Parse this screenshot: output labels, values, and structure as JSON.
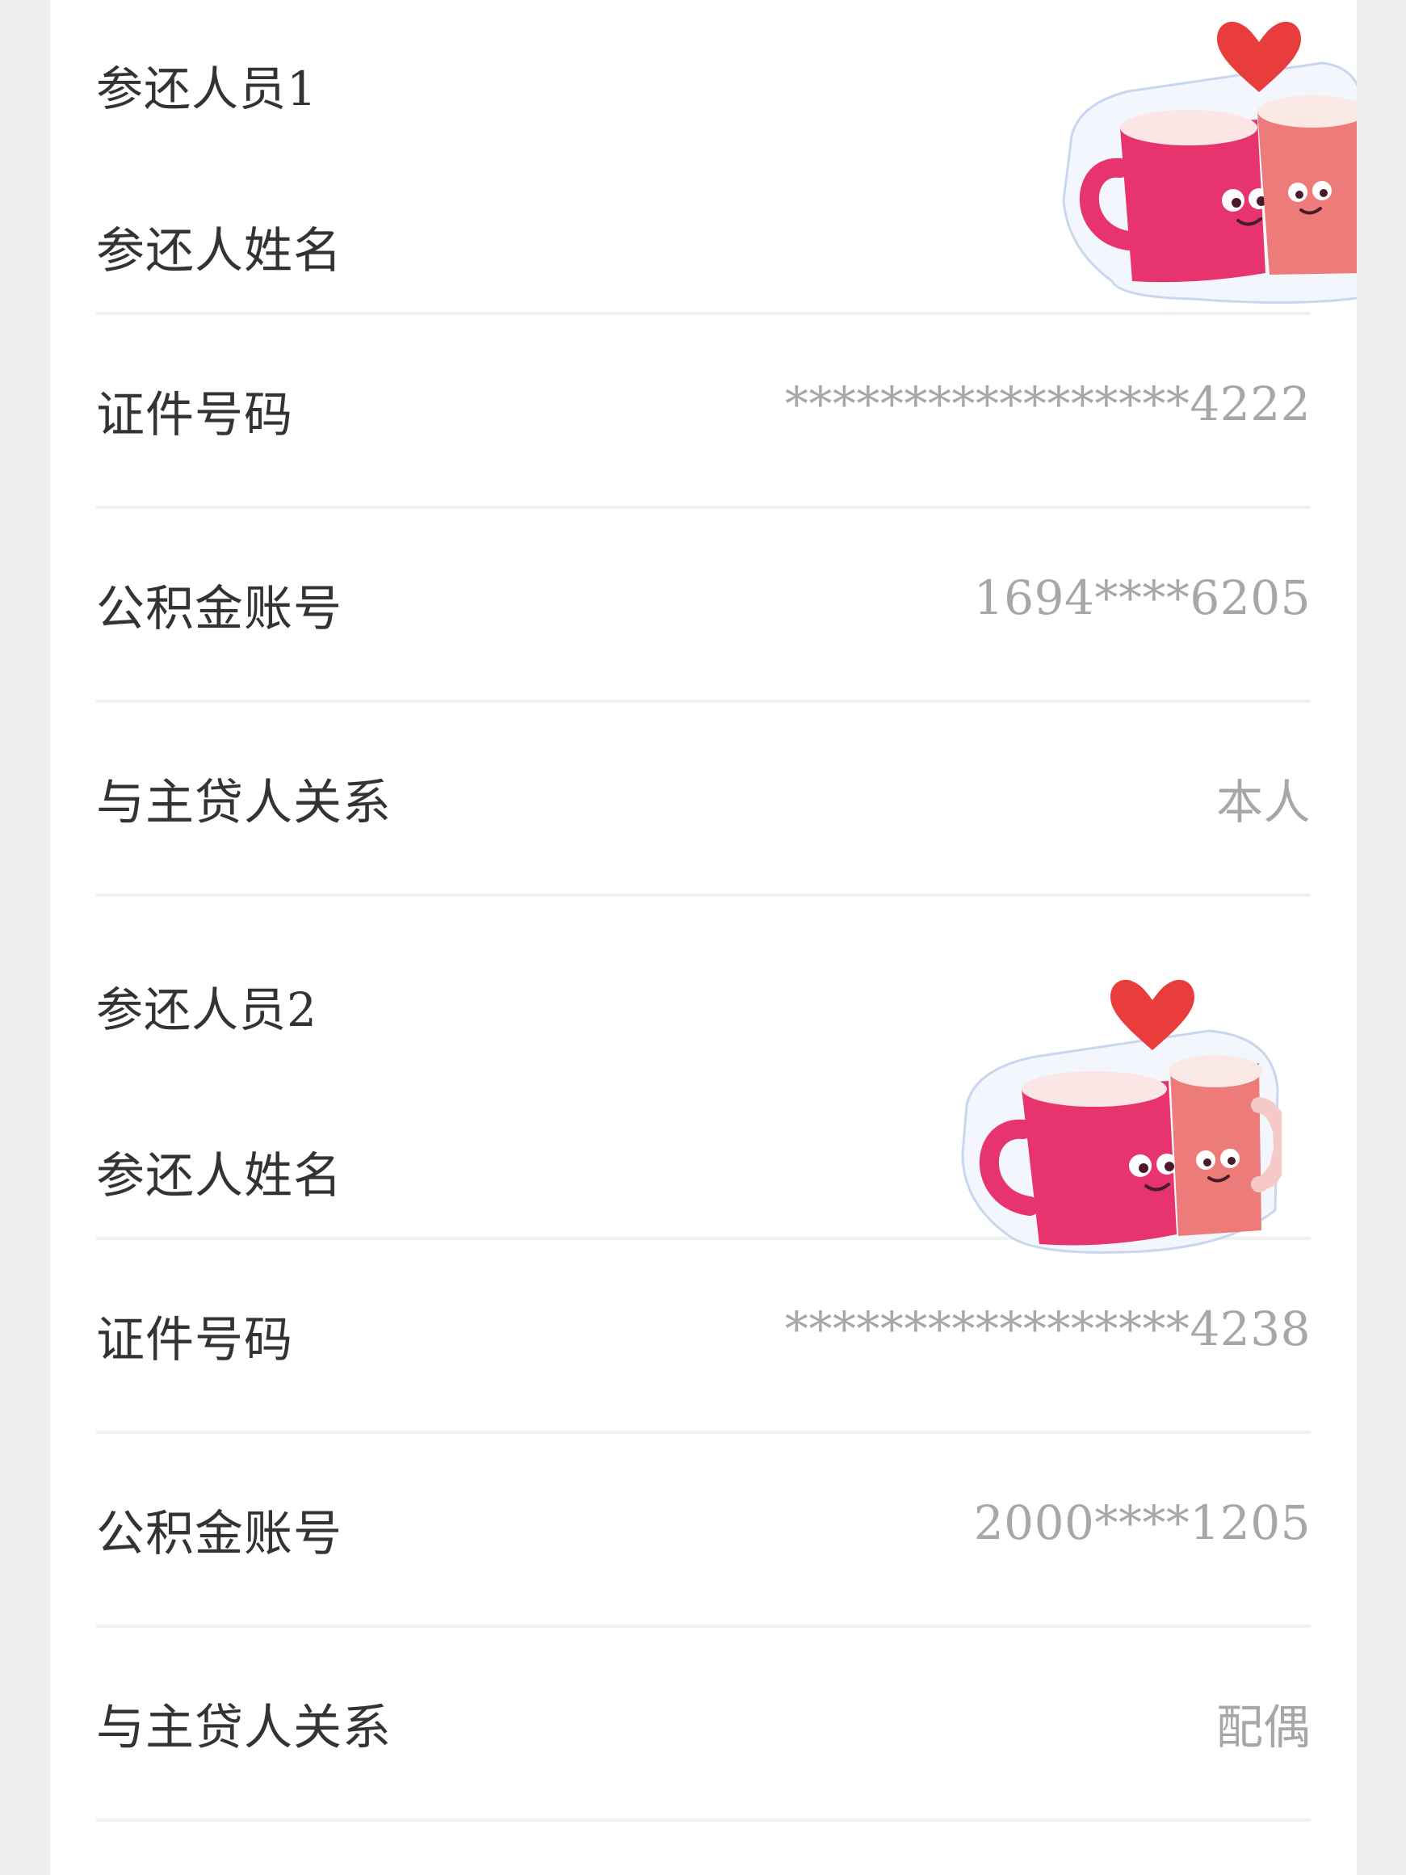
{
  "participants": [
    {
      "title": "参还人员1",
      "name_label": "参还人姓名",
      "id_label": "证件号码",
      "id_value": "*****************4222",
      "account_label": "公积金账号",
      "account_value": "1694****6205",
      "relation_label": "与主贷人关系",
      "relation_value": "本人"
    },
    {
      "title": "参还人员2",
      "name_label": "参还人姓名",
      "id_label": "证件号码",
      "id_value": "*****************4238",
      "account_label": "公积金账号",
      "account_value": "2000****1205",
      "relation_label": "与主贷人关系",
      "relation_value": "配偶"
    }
  ],
  "stickers": [
    {
      "icon": "couple-mugs-heart-icon"
    },
    {
      "icon": "couple-mugs-heart-icon"
    }
  ],
  "colors": {
    "page_background": "#eeeeee",
    "card_background": "#ffffff",
    "label_text": "#333333",
    "value_text": "#a7a7a7",
    "divider": "#f1f1f1",
    "mug_pink": "#e7346f",
    "mug_salmon": "#ec7b79",
    "heart_red": "#e93c3c"
  }
}
